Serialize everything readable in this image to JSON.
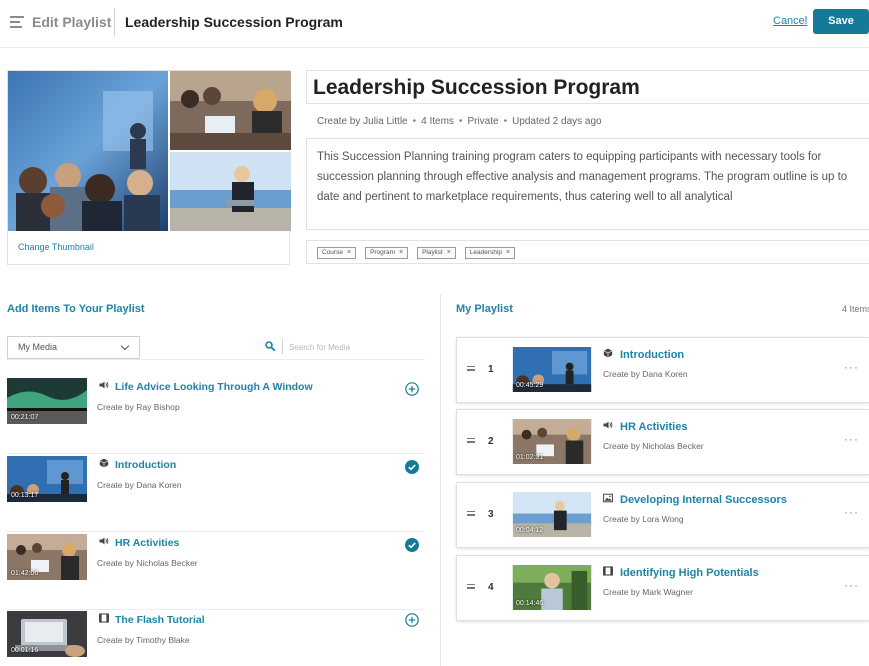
{
  "header": {
    "edit_label": "Edit Playlist",
    "title": "Leadership Succession Program",
    "cancel_label": "Cancel",
    "save_label": "Save"
  },
  "thumbnail": {
    "change_label": "Change Thumbnail"
  },
  "details": {
    "title": "Leadership Succession Program",
    "author": "Create by Julia Little",
    "items": "4 Items",
    "visibility": "Private",
    "updated": "Updated 2 days ago",
    "description": "This Succession Planning training program caters to equipping participants with necessary tools for succession planning through effective analysis and management programs. The program outline is up to date and pertinent to marketplace requirements, thus catering well to all analytical",
    "tags": [
      "Course",
      "Program",
      "Playlist",
      "Leadership"
    ]
  },
  "add_section": {
    "title": "Add Items To Your Playlist",
    "select_value": "My Media",
    "search_placeholder": "Search for Media",
    "items": [
      {
        "title": "Life Advice Looking Through A Window",
        "author": "Create by Ray Bishop",
        "duration": "00:21:07",
        "type": "audio-icon",
        "added": false
      },
      {
        "title": "Introduction",
        "author": "Create by Dana Koren",
        "duration": "00:13:17",
        "type": "video-icon",
        "added": true
      },
      {
        "title": "HR Activities",
        "author": "Create by Nicholas Becker",
        "duration": "01:42:06",
        "type": "audio-icon",
        "added": true
      },
      {
        "title": "The Flash Tutorial",
        "author": "Create by Timothy Blake",
        "duration": "00:01:16",
        "type": "film-icon",
        "added": false
      }
    ]
  },
  "playlist": {
    "title": "My Playlist",
    "count": "4 Items",
    "items": [
      {
        "num": "1",
        "title": "Introduction",
        "author": "Create by Dana Koren",
        "duration": "00:45:29",
        "type": "video-icon"
      },
      {
        "num": "2",
        "title": "HR Activities",
        "author": "Create by Nicholas Becker",
        "duration": "01:02:31",
        "type": "audio-icon"
      },
      {
        "num": "3",
        "title": "Developing Internal Successors",
        "author": "Create by Lora Wong",
        "duration": "00:04:12",
        "type": "image-icon"
      },
      {
        "num": "4",
        "title": "Identifying High Potentials",
        "author": "Create by Mark Wagner",
        "duration": "00:14:46",
        "type": "film-icon"
      }
    ]
  },
  "colors": {
    "accent": "#1b85a6",
    "save_button": "#147a97"
  }
}
